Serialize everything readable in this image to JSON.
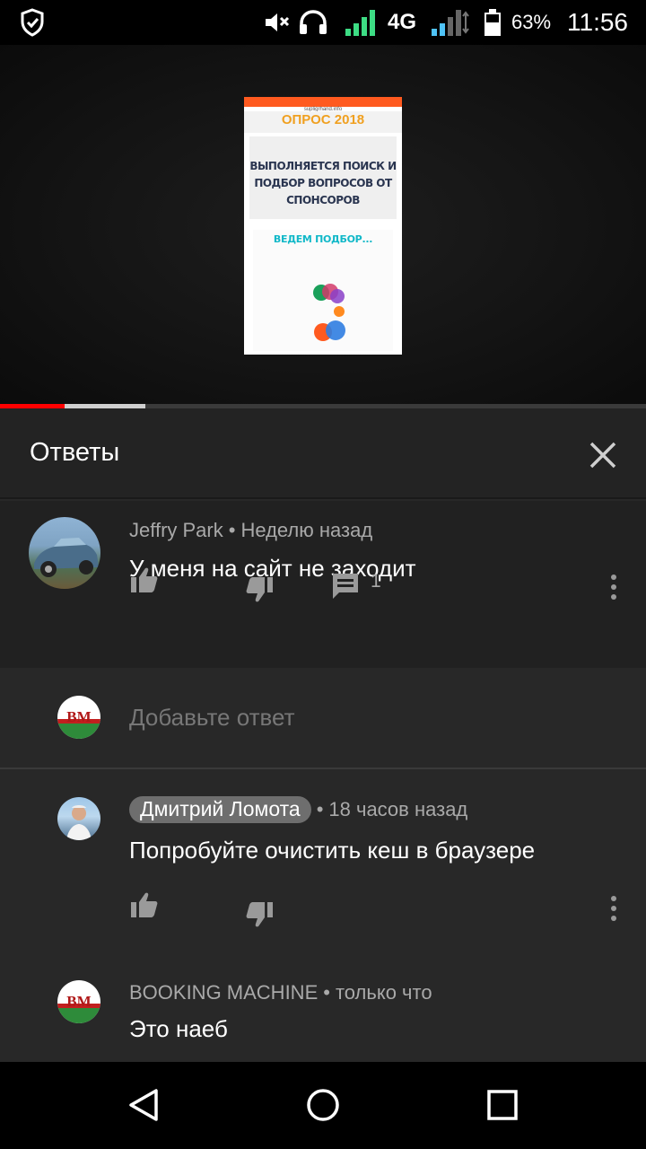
{
  "status_bar": {
    "battery": "63%",
    "time": "11:56",
    "network": "4G",
    "icons": [
      "shield-check-icon",
      "mute-icon",
      "headphones-icon",
      "signal-icon",
      "signal-2-icon",
      "battery-icon"
    ]
  },
  "video": {
    "site_url": "supligrhand.info",
    "site_title": "ОПРОС 2018",
    "heading_line1": "ВЫПОЛНЯЕТСЯ ПОИСК И",
    "heading_line2": "ПОДБОР ВОПРОСОВ ОТ",
    "heading_line3": "СПОНСОРОВ",
    "sub": "ВЕДЕМ ПОДБОР...",
    "progress_played": 0.1,
    "progress_buffered": 0.225
  },
  "panel": {
    "title": "Ответы",
    "close_icon": "close-icon"
  },
  "main_comment": {
    "author": "Jeffry Park",
    "separator": "•",
    "time": "Неделю назад",
    "text": "У меня на сайт не заходит",
    "reply_count": "1"
  },
  "add_reply": {
    "placeholder": "Добавьте ответ",
    "avatar_text": "BM"
  },
  "replies": [
    {
      "author": "Дмитрий Ломота",
      "separator": "•",
      "time": "18 часов назад",
      "text": "Попробуйте очистить кеш в браузере"
    },
    {
      "author": "BOOKING MACHINE",
      "separator": "•",
      "time": "только что",
      "text": "Это наеб",
      "avatar_text": "BM"
    }
  ],
  "colors": {
    "accent_red": "#ff0000",
    "panel_bg": "#282828",
    "comment_bg": "#212121"
  }
}
